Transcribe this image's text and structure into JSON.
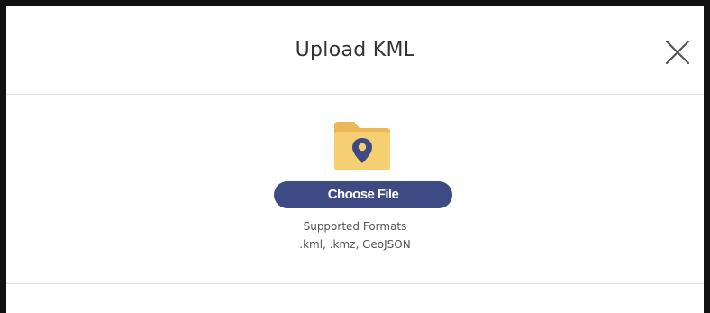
{
  "dialog": {
    "title": "Upload KML",
    "close_icon": "close-icon"
  },
  "upload": {
    "folder_icon": "folder-location-pin-icon",
    "choose_file_label": "Choose File",
    "supported_formats_label": "Supported Formats",
    "supported_formats": ".kml, .kmz, GeoJSON"
  },
  "colors": {
    "button_bg": "#3e4a84",
    "folder_yellow": "#f7cf73",
    "pin_color": "#3e4a84"
  }
}
